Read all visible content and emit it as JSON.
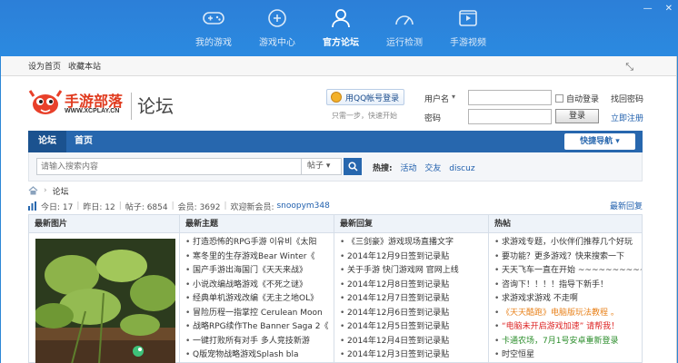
{
  "topnav": [
    {
      "label": "我的游戏",
      "icon": "gamepad-icon"
    },
    {
      "label": "游戏中心",
      "icon": "game-center-icon"
    },
    {
      "label": "官方论坛",
      "icon": "forum-user-icon"
    },
    {
      "label": "运行检测",
      "icon": "detect-icon"
    },
    {
      "label": "手游视频",
      "icon": "video-icon"
    }
  ],
  "active_topnav": "官方论坛",
  "window": {
    "minimize": "—",
    "close": "✕"
  },
  "favbar": {
    "set_home": "设为首页",
    "bookmark": "收藏本站",
    "expand": "⤡"
  },
  "logo": {
    "title": "手游部落",
    "url": "WWW.XCPLAY.CN",
    "forum": "论坛"
  },
  "qq": {
    "button": "用QQ帐号登录",
    "sub": "只需一步，快速开始"
  },
  "login": {
    "username_label": "用户名",
    "password_label": "密码",
    "auto_login": "自动登录",
    "submit": "登录",
    "forgot": "找回密码",
    "register": "立即注册"
  },
  "nav": {
    "forum": "论坛",
    "home": "首页",
    "quick": "快捷导航 ▾"
  },
  "search": {
    "placeholder": "请输入搜索内容",
    "type": "帖子 ▾",
    "hot_label": "热搜:",
    "hot_tags": [
      "活动",
      "交友",
      "discuz"
    ]
  },
  "crumb": {
    "home_icon": "house-icon",
    "arrow": "›",
    "label": "论坛"
  },
  "stats": {
    "today": "今日: 17",
    "yesterday": "昨日: 12",
    "posts": "帖子: 6854",
    "members": "会员: 3692",
    "newest_label": "欢迎新会员:",
    "newest_user": "snoopym348",
    "latest": "最新回复"
  },
  "columns": {
    "images": {
      "title": "最新图片"
    },
    "topics": {
      "title": "最新主题",
      "items": [
        "打造恐怖的RPG手游 이유비《太阳",
        "寒冬里的生存游戏Bear Winter《",
        "国产手游出海国门《天天来战》",
        "小说改编战略游戏《不死之谜》",
        "经典单机游戏改编《无主之地OL》",
        "冒险历程一指掌控 Cerulean Moon",
        "战略RPG续作The Banner Saga 2《",
        "一键打败所有对手 多人竞技新游",
        "Q版宠物战略游戏Splash bla"
      ]
    },
    "replies": {
      "title": "最新回复",
      "items": [
        "《三剑豪》游戏现场直播文字",
        "2014年12月9日签到记录贴",
        "关于手游 快门游戏网 官网上线",
        "2014年12月8日签到记录贴",
        "2014年12月7日签到记录贴",
        "2014年12月6日签到记录贴",
        "2014年12月5日签到记录贴",
        "2014年12月4日签到记录贴",
        "2014年12月3日签到记录贴"
      ]
    },
    "hot": {
      "title": "热帖",
      "items": [
        {
          "text": "求游戏专题，小伙伴们推荐几个好玩",
          "style": ""
        },
        {
          "text": "要功能？更多游戏？快来搜索一下",
          "style": ""
        },
        {
          "text": "天天飞车一直在开始 ~~~~~~~~~~~",
          "style": ""
        },
        {
          "text": "咨询下！！！！指导下新手！",
          "style": ""
        },
        {
          "text": "求游戏求游戏 不走啊",
          "style": ""
        },
        {
          "text": "《天天酷跑》电脑版玩法教程 。",
          "style": "orange"
        },
        {
          "text": "“电脑未开启游戏加速” 请帮我！",
          "style": "red"
        },
        {
          "text": "卡通农场，7月1号安卓重新登录",
          "style": "green"
        },
        {
          "text": "时空恒星",
          "style": ""
        }
      ]
    }
  },
  "colors": {
    "brand_blue": "#2c7fd8",
    "nav_blue": "#2767ae",
    "logo_red": "#e03a1e"
  }
}
